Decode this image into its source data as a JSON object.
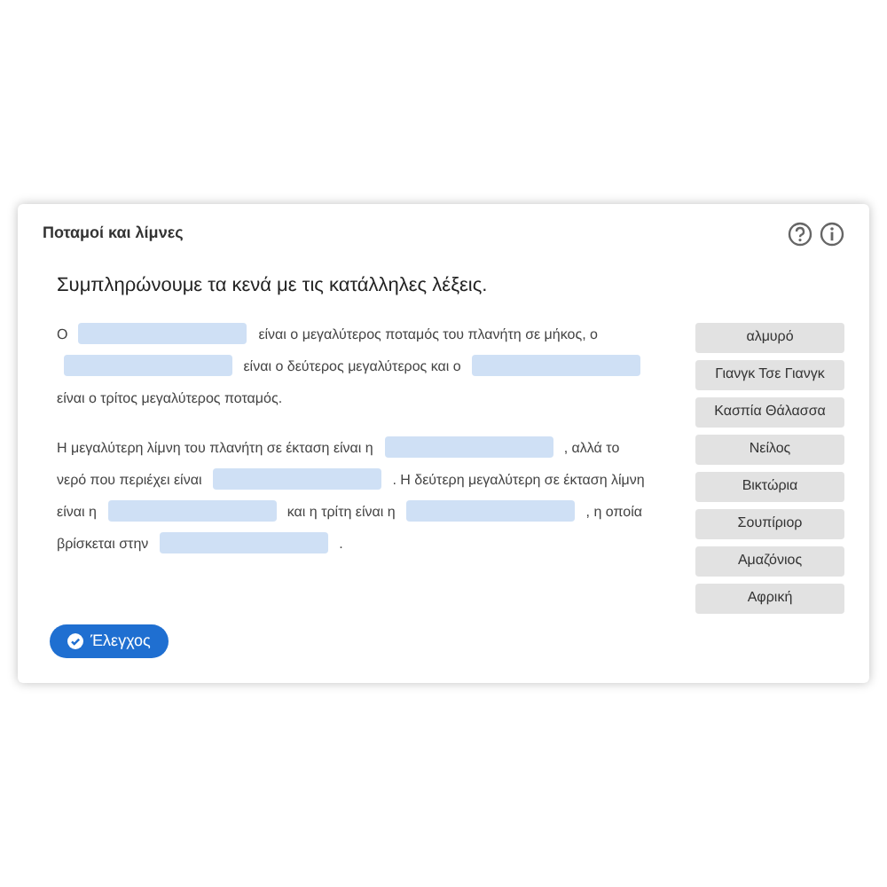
{
  "title": "Ποταμοί και λίμνες",
  "instruction": "Συμπληρώνουμε τα κενά με τις κατάλληλες λέξεις.",
  "paragraphs": [
    {
      "parts": [
        {
          "kind": "text",
          "text": "Ο"
        },
        {
          "kind": "blank"
        },
        {
          "kind": "text",
          "text": "είναι ο μεγαλύτερος ποταμός του πλανήτη σε μήκος, ο"
        },
        {
          "kind": "blank"
        },
        {
          "kind": "text",
          "text": "είναι ο δεύτερος μεγαλύτερος και ο"
        },
        {
          "kind": "blank"
        },
        {
          "kind": "text",
          "text": "είναι ο τρίτος μεγαλύτερος ποταμός."
        }
      ]
    },
    {
      "parts": [
        {
          "kind": "text",
          "text": "Η μεγαλύτερη λίμνη του πλανήτη σε έκταση είναι η"
        },
        {
          "kind": "blank"
        },
        {
          "kind": "text",
          "text": ", αλλά το"
        },
        {
          "kind": "text",
          "text": "νερό που περιέχει είναι"
        },
        {
          "kind": "blank"
        },
        {
          "kind": "text",
          "text": ". Η δεύτερη μεγαλύτερη σε έκταση λίμνη"
        },
        {
          "kind": "text",
          "text": "είναι η"
        },
        {
          "kind": "blank"
        },
        {
          "kind": "text",
          "text": "και η τρίτη είναι η"
        },
        {
          "kind": "blank"
        },
        {
          "kind": "text",
          "text": ", η οποία"
        },
        {
          "kind": "text",
          "text": "βρίσκεται στην"
        },
        {
          "kind": "blank"
        },
        {
          "kind": "text",
          "text": "."
        }
      ]
    }
  ],
  "word_bank": [
    "αλμυρό",
    "Γιανγκ Τσε Γιανγκ",
    "Κασπία Θάλασσα",
    "Νείλος",
    "Βικτώρια",
    "Σουπίριορ",
    "Αμαζόνιος",
    "Αφρική"
  ],
  "check_button": "Έλεγχος"
}
